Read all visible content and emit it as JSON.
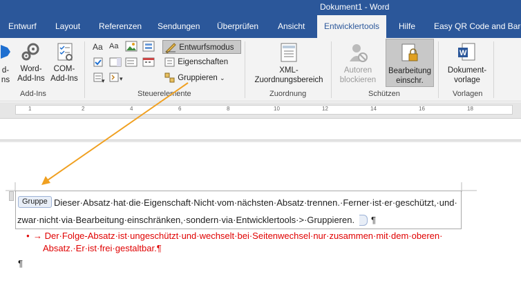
{
  "window": {
    "title": "Dokument1  -  Word"
  },
  "tabs": [
    {
      "label": "Entwurf"
    },
    {
      "label": "Layout"
    },
    {
      "label": "Referenzen"
    },
    {
      "label": "Sendungen"
    },
    {
      "label": "Überprüfen"
    },
    {
      "label": "Ansicht"
    },
    {
      "label": "Entwicklertools"
    },
    {
      "label": "Hilfe"
    },
    {
      "label": "Easy QR Code and Barco"
    }
  ],
  "ribbon": {
    "addins": {
      "b1": "d-",
      "b1b": "ns",
      "word_addins_1": "Word-",
      "word_addins_2": "Add-Ins",
      "com_addins_1": "COM-",
      "com_addins_2": "Add-Ins",
      "label": "Add-Ins"
    },
    "controls": {
      "design_mode": "Entwurfsmodus",
      "properties": "Eigenschaften",
      "group": "Gruppieren",
      "label": "Steuerelemente"
    },
    "mapping": {
      "xml_1": "XML-",
      "xml_2": "Zuordnungsbereich",
      "label": "Zuordnung"
    },
    "protect": {
      "block_authors_1": "Autoren",
      "block_authors_2": "blockieren",
      "restrict_1": "Bearbeitung",
      "restrict_2": "einschr.",
      "label": "Schützen"
    },
    "templates": {
      "doc_template_1": "Dokument-",
      "doc_template_2": "vorlage",
      "label": "Vorlagen"
    }
  },
  "ruler": {
    "numbers": [
      "1",
      "2",
      "4",
      "6",
      "8",
      "10",
      "12",
      "14",
      "16",
      "18"
    ]
  },
  "document": {
    "control_tag": "Gruppe",
    "para1_line1": "Dieser·Absatz·hat·die·Eigenschaft·Nicht·vom·nächsten·Absatz·trennen.·Ferner·ist·er·geschützt,·und·",
    "para1_line2": "zwar·nicht·via·Bearbeitung·einschränken,·sondern·via·Entwicklertools·>·Gruppieren.",
    "pilcrow": "¶",
    "para2_line1": "→ Der·Folge-Absatz·ist·ungeschützt·und·wechselt·bei·Seitenwechsel·nur·zusammen·mit·dem·oberen·",
    "para2_line2": "Absatz.·Er·ist·frei·gestaltbar.¶",
    "para3": "¶"
  },
  "colors": {
    "accent": "#2b579a",
    "arrow": "#f0a020",
    "red_text": "#e00000"
  }
}
